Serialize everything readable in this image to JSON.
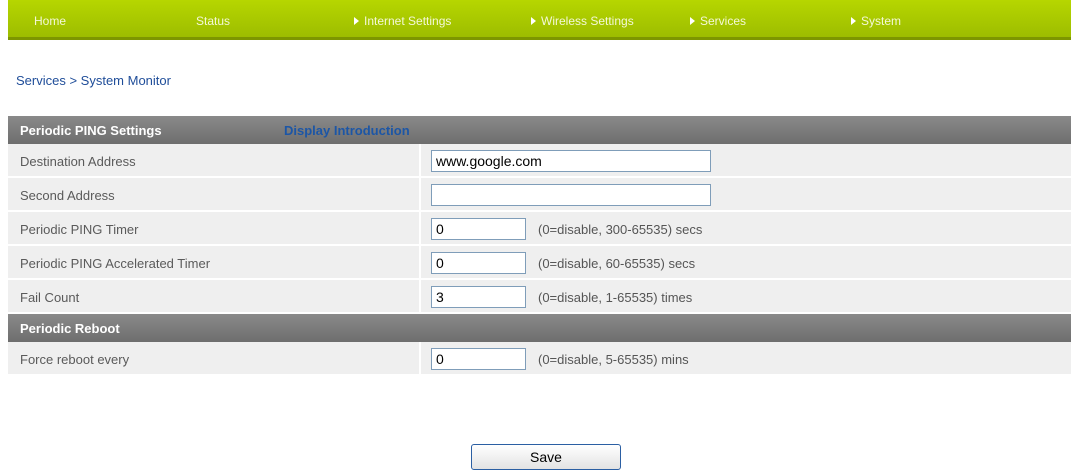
{
  "nav": {
    "items": [
      {
        "label": "Home",
        "has_arrow": false
      },
      {
        "label": "Status",
        "has_arrow": false
      },
      {
        "label": "Internet Settings",
        "has_arrow": true
      },
      {
        "label": "Wireless Settings",
        "has_arrow": true
      },
      {
        "label": "Services",
        "has_arrow": true
      },
      {
        "label": "System",
        "has_arrow": true
      }
    ]
  },
  "breadcrumb": "Services > System Monitor",
  "ping_section": {
    "title": "Periodic PING Settings",
    "intro_link": "Display Introduction",
    "rows": [
      {
        "label": "Destination Address",
        "value": "www.google.com",
        "hint": ""
      },
      {
        "label": "Second Address",
        "value": "",
        "hint": ""
      },
      {
        "label": "Periodic PING Timer",
        "value": "0",
        "hint": "(0=disable, 300-65535) secs"
      },
      {
        "label": "Periodic PING Accelerated Timer",
        "value": "0",
        "hint": "(0=disable, 60-65535) secs"
      },
      {
        "label": "Fail Count",
        "value": "3",
        "hint": "(0=disable, 1-65535) times"
      }
    ]
  },
  "reboot_section": {
    "title": "Periodic Reboot",
    "rows": [
      {
        "label": "Force reboot every",
        "value": "0",
        "hint": "(0=disable, 5-65535) mins"
      }
    ]
  },
  "save_label": "Save",
  "colors": {
    "nav_green": "#a8c800",
    "section_header": "#7a7a7a",
    "link_blue": "#1f4d99",
    "row_bg": "#efefef"
  }
}
